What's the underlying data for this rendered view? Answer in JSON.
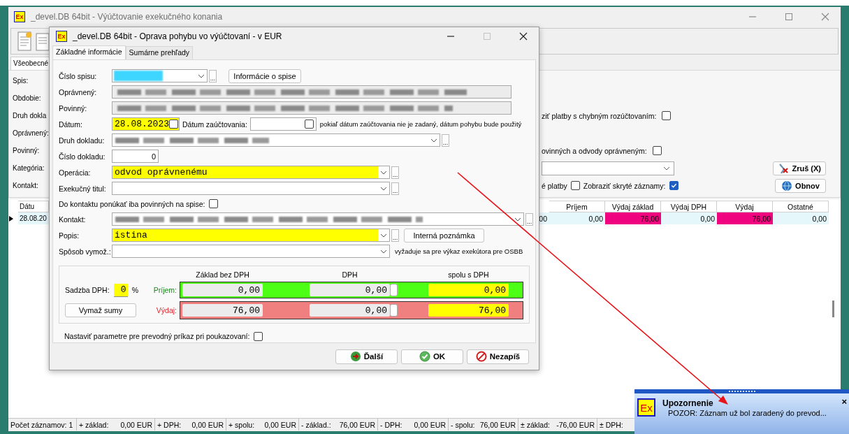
{
  "main_window": {
    "logo": "Ex",
    "title": "_devel.DB 64bit -  Výúčtovanie exekučného konania",
    "tab": "Všeobecné",
    "filter_labels": [
      "Spis:",
      "Obdobie:",
      "Druh dokla",
      "Oprávnený:",
      "Povinný:",
      "Kategória:",
      "Kontakt:"
    ],
    "options": [
      {
        "label": "ziť platby s chybným rozúčtovaním:",
        "checked": false
      },
      {
        "label": "ovinných a odvody oprávneným:",
        "checked": false
      }
    ],
    "view_checks": [
      {
        "label": "é platby",
        "checked": false
      },
      {
        "label": "Zobraziť skryté záznamy:",
        "checked": true
      }
    ],
    "buttons": [
      {
        "kind": "cancel",
        "label": "Zruš (X)"
      },
      {
        "kind": "refresh",
        "label": "Obnov"
      }
    ],
    "grid": {
      "left_columns": [
        "Dátu"
      ],
      "right_columns": [
        "Príjem",
        "Výdaj základ",
        "Výdaj DPH",
        "Výdaj",
        "Ostatné"
      ],
      "rows": [
        {
          "current": true,
          "left_cells": [
            "28.08.20"
          ],
          "cut_cell": "00",
          "right_cells": [
            {
              "text": "0,00",
              "highlight": false
            },
            {
              "text": "76,00",
              "highlight": true
            },
            {
              "text": "0,00",
              "highlight": false
            },
            {
              "text": "76,00",
              "highlight": true
            },
            {
              "text": "0,00",
              "highlight": false
            }
          ]
        }
      ]
    },
    "status_bar": [
      {
        "label": "Počet záznamov: 1"
      },
      {
        "label": "+ základ:",
        "value": "0,00 EUR"
      },
      {
        "label": "+ DPH:",
        "value": "0,00 EUR"
      },
      {
        "label": "+ spolu:",
        "value": "0,00 EUR"
      },
      {
        "label": "- základ.:",
        "value": "76,00 EUR"
      },
      {
        "label": "- DPH:",
        "value": "0,00 EUR"
      },
      {
        "label": "- spolu:",
        "value": "76,00 EUR"
      },
      {
        "label": "± základ:",
        "value": "-76,00 EUR"
      },
      {
        "label": "± DPH:"
      }
    ]
  },
  "dialog": {
    "logo": "Ex",
    "title": "_devel.DB 64bit -  Oprava pohybu vo výúčtovaní - v EUR",
    "maximize_enabled": false,
    "tabs": [
      {
        "label": "Základné informácie",
        "selected": true
      },
      {
        "label": "Sumárne prehľady",
        "selected": false
      }
    ],
    "case_number": {
      "label": "Číslo spisu:",
      "redacted": true,
      "focused": true,
      "more": "...",
      "button": "Informácie o spise"
    },
    "creditor": {
      "label": "Oprávnený:",
      "redacted": true
    },
    "debtor": {
      "label": "Povinný:",
      "redacted": true
    },
    "date": {
      "label": "Dátum:",
      "value": "28.08.2023",
      "required": true,
      "checked": false
    },
    "posting_date": {
      "label": "Dátum zaúčtovania:",
      "checked": false,
      "note": "pokiaľ dátum zaúčtovania nie je zadaný, dátum pohybu bude použitý"
    },
    "document_type": {
      "label": "Druh dokladu:",
      "redacted": true,
      "more": "..."
    },
    "document_number": {
      "label": "Číslo dokladu:",
      "value": "0"
    },
    "operation": {
      "label": "Operácia:",
      "value": "odvod oprávnenému",
      "required": true,
      "more": "..."
    },
    "enforcement_title": {
      "label": "Exekučný titul:",
      "more": "..."
    },
    "only_debtors": {
      "label": "Do kontaktu ponúkať iba povinných na spise:",
      "checked": false
    },
    "contact": {
      "label": "Kontakt:",
      "redacted": true,
      "more": "..."
    },
    "description": {
      "label": "Popis:",
      "value": "istina",
      "required": true,
      "more": "...",
      "button": "Interná poznámka"
    },
    "recovery_method": {
      "label": "Spôsob vymož.:",
      "note": "vyžaduje sa pre výkaz exekútora pre OSBB"
    },
    "amounts": {
      "headers": [
        "Základ bez DPH",
        "DPH",
        "spolu s DPH"
      ],
      "vat_label": "Sadzba DPH:",
      "vat_rate": "0",
      "vat_rate_required": true,
      "percent": "%",
      "clear_button": "Vymaž sumy",
      "rows": [
        {
          "kind": "income",
          "label": "Príjem:",
          "base": "0,00",
          "vat": "0,00",
          "vat_checked": false,
          "total": "0,00"
        },
        {
          "kind": "expense",
          "label": "Výdaj:",
          "base": "76,00",
          "vat": "0,00",
          "vat_checked": false,
          "total": "76,00"
        }
      ]
    },
    "transfer_params": {
      "label": "Nastaviť parametre pre prevodný príkaz pri poukazovaní:",
      "checked": false
    },
    "buttons": [
      {
        "kind": "next",
        "label": "Ďalší"
      },
      {
        "kind": "ok",
        "label": "OK"
      },
      {
        "kind": "cancel",
        "label": "Nezapíš"
      }
    ]
  },
  "toast": {
    "logo": "Ex",
    "title": "Upozornenie",
    "message": "POZOR: Záznam už bol zaradený do prevod...",
    "close": "×"
  }
}
